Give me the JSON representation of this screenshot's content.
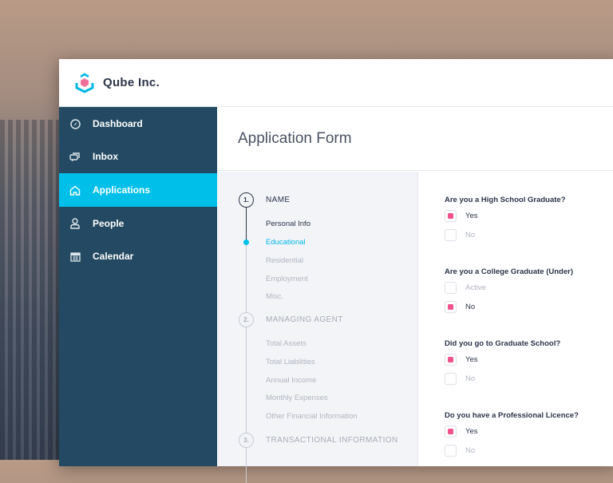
{
  "app": {
    "brand": "Qube Inc."
  },
  "sidebar": {
    "items": [
      {
        "label": "Dashboard",
        "icon": "compass-icon",
        "active": false
      },
      {
        "label": "Inbox",
        "icon": "chat-icon",
        "active": false
      },
      {
        "label": "Applications",
        "icon": "home-icon",
        "active": true
      },
      {
        "label": "People",
        "icon": "person-icon",
        "active": false
      },
      {
        "label": "Calendar",
        "icon": "calendar-icon",
        "active": false
      }
    ]
  },
  "page": {
    "title": "Application Form"
  },
  "steps": [
    {
      "num": "1.",
      "title": "NAME",
      "items": [
        "Personal Info",
        "Educational",
        "Residential",
        "Employment",
        "Misc."
      ]
    },
    {
      "num": "2.",
      "title": "MANAGING AGENT",
      "items": [
        "Total Assets",
        "Total Liabilities",
        "Annual Income",
        "Monthly Expenses",
        "Other Financial Information"
      ]
    },
    {
      "num": "3.",
      "title": "TRANSACTIONAL INFORMATION",
      "items": []
    }
  ],
  "form": {
    "questions": [
      {
        "q": "Are you a High School Graduate?",
        "options": [
          {
            "label": "Yes",
            "checked": true
          },
          {
            "label": "No",
            "checked": false
          }
        ]
      },
      {
        "q": "Are you a College Graduate (Under)",
        "options": [
          {
            "label": "Active",
            "checked": false
          },
          {
            "label": "No",
            "checked": true
          }
        ]
      },
      {
        "q": "Did you go to Graduate School?",
        "options": [
          {
            "label": "Yes",
            "checked": true
          },
          {
            "label": "No",
            "checked": false
          }
        ]
      },
      {
        "q": "Do you have a Professional Licence?",
        "options": [
          {
            "label": "Yes",
            "checked": true
          },
          {
            "label": "No",
            "checked": false
          }
        ]
      }
    ]
  },
  "colors": {
    "accent": "#00c0ea",
    "check": "#f0528a",
    "sidebar": "#234a62"
  }
}
